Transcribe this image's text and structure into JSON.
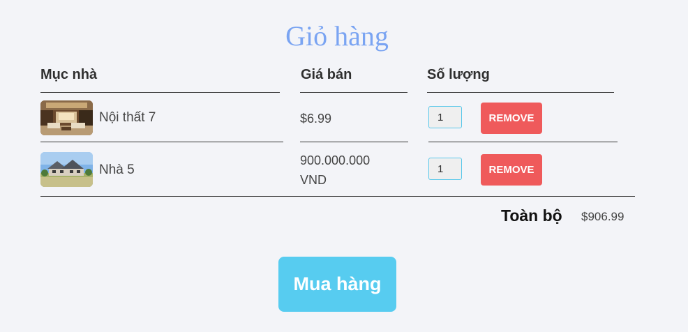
{
  "cart": {
    "title": "Giỏ hàng",
    "headers": {
      "item": "Mục nhà",
      "price": "Giá bán",
      "quantity": "Số lượng"
    },
    "items": [
      {
        "name": "Nội thất 7",
        "price_line1": "$6.99",
        "price_line2": "",
        "quantity": "1",
        "remove_label": "REMOVE",
        "image": "living-room-interior"
      },
      {
        "name": "Nhà 5",
        "price_line1": "900.000.000",
        "price_line2": "VND",
        "quantity": "1",
        "remove_label": "REMOVE",
        "image": "house-exterior"
      }
    ],
    "total_label": "Toàn bộ",
    "total_value": "$906.99",
    "checkout_label": "Mua hàng"
  },
  "colors": {
    "background": "#f3f4f8",
    "title": "#7aa4f2",
    "remove_button": "#ef5a5b",
    "checkout_button": "#57ccf0",
    "qty_border": "#5bc8ea"
  }
}
